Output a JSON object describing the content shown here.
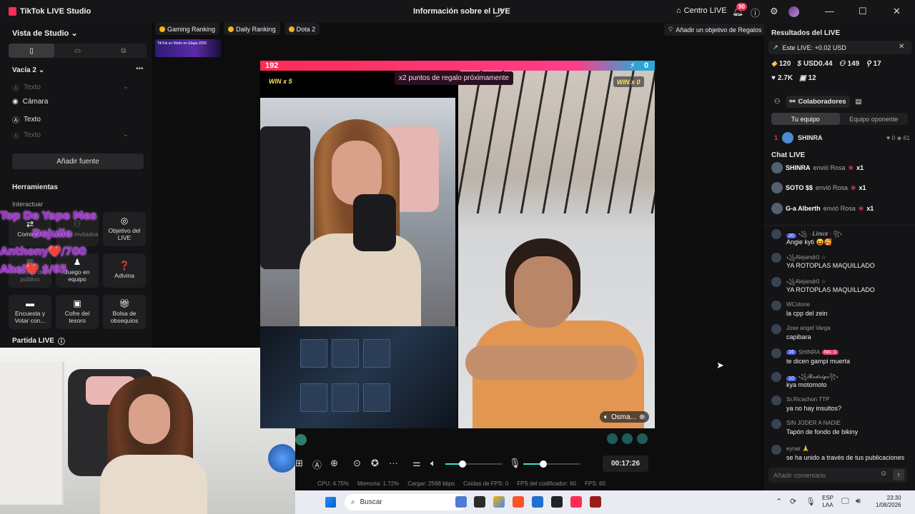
{
  "titlebar": {
    "app_name": "TikTok LIVE Studio",
    "title": "Información sobre el LIVE",
    "live_center": "Centro LIVE",
    "notification_count": "90"
  },
  "left": {
    "studio_view": "Vista de Studio",
    "scene": "Vacía 2",
    "sources": [
      {
        "label": "Texto",
        "dim": true
      },
      {
        "label": "Cámara",
        "dim": false
      },
      {
        "label": "Texto",
        "dim": false
      },
      {
        "label": "Texto",
        "dim": true
      }
    ],
    "add_source": "Añadir fuente",
    "tools_title": "Herramientas",
    "tools_sub": "Interactuar",
    "tools": [
      {
        "label": "Comisión",
        "icon": "commission-icon"
      },
      {
        "label": "Varias invitados",
        "icon": "guests-icon"
      },
      {
        "label": "Objetivo del LIVE",
        "icon": "goal-icon"
      },
      {
        "label": "Favorito del público",
        "icon": "favorite-icon"
      },
      {
        "label": "Juego en equipo",
        "icon": "team-game-icon"
      },
      {
        "label": "Adivina",
        "icon": "guess-icon"
      },
      {
        "label": "Encuesta y Votar con...",
        "icon": "poll-icon"
      },
      {
        "label": "Cofre del tesoro",
        "icon": "treasure-icon"
      },
      {
        "label": "Bolsa de obsequios",
        "icon": "gift-bag-icon"
      }
    ],
    "partida": "Partida LIVE",
    "overlay_lines": [
      "Top De Yape  Mes",
      "Dejulio",
      "Anthony❤️/700",
      "Abel❤️     $/65"
    ]
  },
  "center": {
    "chips": [
      "Gaming Ranking",
      "Daily Ranking",
      "Dota 2"
    ],
    "goal_button": "Añadir un objetivo de Regalos",
    "thumb_text": "TikTok en Modo en Etapa 2026",
    "score_left": "192",
    "score_right": "0",
    "gift_banner": "x2 puntos de regalo próximamente",
    "win_left": "WIN x 5",
    "win_right": "WIN x 0",
    "opponent_name": "Osma...",
    "timer": "00:17:26",
    "stats": {
      "cpu": "CPU:  4.75%",
      "memory": "Memoria:  1.72%",
      "upload": "Cargar:  2568 kbps",
      "fps_drop": "Caídas de FPS:  0",
      "encoder": "FPS del codificador:  60",
      "fps": "FPS:  60"
    },
    "mic_level": 0.35,
    "volume_level": 0.3
  },
  "right": {
    "title": "Resultados del LIVE",
    "live_delta": "Este LIVE: +0.02 USD",
    "metrics_row1": [
      {
        "icon": "diamond-icon",
        "value": "120"
      },
      {
        "icon": "dollar-icon",
        "value": "USD0.44"
      },
      {
        "icon": "users-icon",
        "value": "149"
      },
      {
        "icon": "follow-icon",
        "value": "17"
      }
    ],
    "metrics_row2": [
      {
        "icon": "heart-icon",
        "value": "2.7K"
      },
      {
        "icon": "gift-icon",
        "value": "12"
      }
    ],
    "collab_label": "Colaboradores",
    "tab_team": "Tu equipo",
    "tab_opponent": "Equipo oponente",
    "rank": {
      "num": "1",
      "name": "SHINRA",
      "likes": "0",
      "coins": "61"
    },
    "chat_title": "Chat LIVE",
    "gifts": [
      {
        "user": "SHINRA",
        "verb": "envió Rosa",
        "count": "x1"
      },
      {
        "user": "SOTO $$",
        "verb": "envió Rosa",
        "count": "x1"
      },
      {
        "user": "G-a Alberth",
        "verb": "envió Rosa",
        "count": "x1"
      }
    ],
    "messages": [
      {
        "level": "20",
        "user": "꧁ · 𝑳𝒊𝒏𝒖𝒙 · ꧂",
        "text": "Angie kyti 😝🥰"
      },
      {
        "level": "",
        "user": "꧁Alejandr0 ☆",
        "text": "YA ROTOPLAS MAQUILLADO"
      },
      {
        "level": "",
        "user": "꧁Alejandr0 ☆",
        "text": "YA ROTOPLAS MAQUILLADO"
      },
      {
        "level": "",
        "user": "WCstone",
        "text": "la cpp del zein"
      },
      {
        "level": "",
        "user": "Jose angel Varga",
        "text": "capibara"
      },
      {
        "level": "16",
        "user": "SHINRA",
        "badge": "No. 1",
        "text": "te dicen gampi muerta"
      },
      {
        "level": "10",
        "user": "꧁𝓡𝓸𝓭𝓻𝓲𝓰𝓸꧂",
        "text": "kya motomoto"
      },
      {
        "level": "",
        "user": "Sr.Ricachon TTP",
        "text": "ya no hay insultos?"
      },
      {
        "level": "",
        "user": "SIN JODER A NADIE",
        "text": "Tapón de fondo de bikiny"
      },
      {
        "level": "",
        "user": "eynar 🙏",
        "text": "se ha unido a través de tus publicaciones"
      }
    ],
    "comment_placeholder": "Añadir comentario"
  },
  "taskbar": {
    "search": "Buscar",
    "lang1": "ESP",
    "lang2": "LAA",
    "time": "23:30",
    "date": "1/08/2026"
  }
}
